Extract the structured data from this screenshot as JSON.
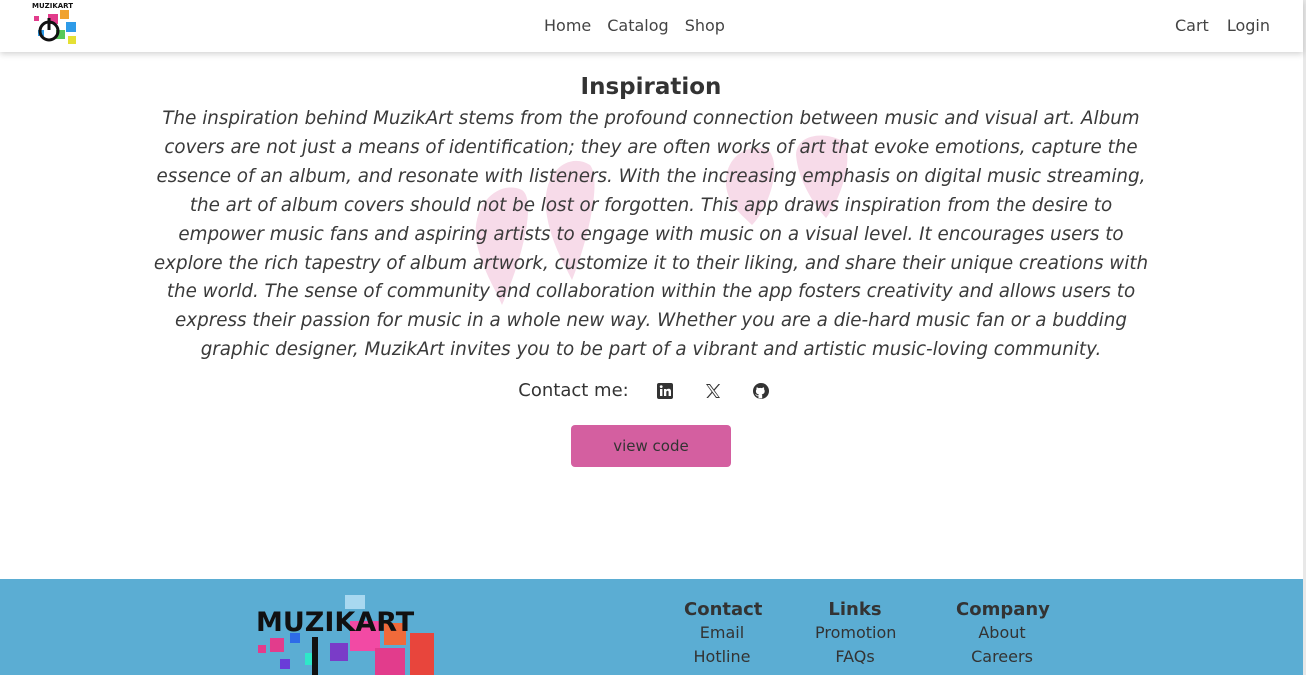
{
  "nav": {
    "logo_text": "MUZIKART",
    "center_links": [
      "Home",
      "Catalog",
      "Shop"
    ],
    "right_links": [
      "Cart",
      "Login"
    ]
  },
  "inspiration": {
    "title": "Inspiration",
    "text": "The inspiration behind MuzikArt stems from the profound connection between music and visual art. Album covers are not just a means of identification; they are often works of art that evoke emotions, capture the essence of an album, and resonate with listeners. With the increasing emphasis on digital music streaming, the art of album covers should not be lost or forgotten. This app draws inspiration from the desire to empower music fans and aspiring artists to engage with music on a visual level. It encourages users to explore the rich tapestry of album artwork, customize it to their liking, and share their unique creations with the world. The sense of community and collaboration within the app fosters creativity and allows users to express their passion for music in a whole new way. Whether you are a die-hard music fan or a budding graphic designer, MuzikArt invites you to be part of a vibrant and artistic music-loving community."
  },
  "contact": {
    "label": "Contact me:",
    "icons": [
      "linkedin-icon",
      "x-twitter-icon",
      "github-icon"
    ]
  },
  "view_code_button": "view code",
  "footer": {
    "logo_text": "MUZIKART",
    "columns": [
      {
        "title": "Contact",
        "links": [
          "Email",
          "Hotline"
        ]
      },
      {
        "title": "Links",
        "links": [
          "Promotion",
          "FAQs"
        ]
      },
      {
        "title": "Company",
        "links": [
          "About",
          "Careers"
        ]
      }
    ]
  },
  "colors": {
    "accent_pink": "#d45fa0",
    "footer_blue": "#5badd3",
    "quote_mark_pink": "#f7dbe9"
  }
}
